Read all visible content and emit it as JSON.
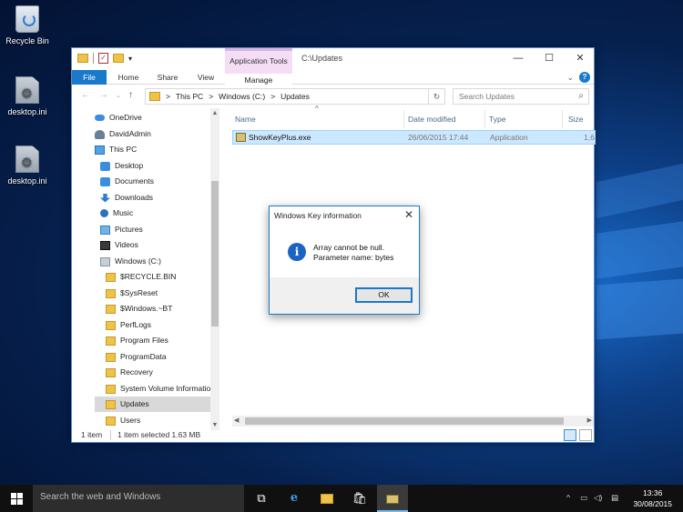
{
  "desktop": {
    "icons": [
      {
        "label": "Recycle Bin",
        "icon": "recycle-bin-icon"
      },
      {
        "label": "desktop.ini",
        "icon": "settings-file-icon"
      },
      {
        "label": "desktop.ini",
        "icon": "settings-file-icon"
      }
    ]
  },
  "explorer": {
    "title": "C:\\Updates",
    "app_tools": "Application Tools",
    "ribbon_tabs": [
      "File",
      "Home",
      "Share",
      "View",
      "Manage"
    ],
    "address": {
      "crumbs": [
        "This PC",
        "Windows (C:)",
        "Updates"
      ],
      "separator": ">"
    },
    "search_placeholder": "Search Updates",
    "nav_items": [
      {
        "label": "OneDrive",
        "icon": "cloud"
      },
      {
        "label": "DavidAdmin",
        "icon": "user"
      },
      {
        "label": "This PC",
        "icon": "pc"
      },
      {
        "label": "Desktop",
        "icon": "blue"
      },
      {
        "label": "Documents",
        "icon": "blue"
      },
      {
        "label": "Downloads",
        "icon": "dl"
      },
      {
        "label": "Music",
        "icon": "music"
      },
      {
        "label": "Pictures",
        "icon": "pics"
      },
      {
        "label": "Videos",
        "icon": "video"
      },
      {
        "label": "Windows (C:)",
        "icon": "drive"
      },
      {
        "label": "$RECYCLE.BIN",
        "icon": "folder"
      },
      {
        "label": "$SysReset",
        "icon": "folder"
      },
      {
        "label": "$Windows.~BT",
        "icon": "folder"
      },
      {
        "label": "PerfLogs",
        "icon": "folder"
      },
      {
        "label": "Program Files",
        "icon": "folder"
      },
      {
        "label": "ProgramData",
        "icon": "folder"
      },
      {
        "label": "Recovery",
        "icon": "folder"
      },
      {
        "label": "System Volume Informatio",
        "icon": "folder"
      },
      {
        "label": "Updates",
        "icon": "folder",
        "selected": true
      },
      {
        "label": "Users",
        "icon": "folder"
      }
    ],
    "columns": [
      "Name",
      "Date modified",
      "Type",
      "Size"
    ],
    "files": [
      {
        "name": "ShowKeyPlus.exe",
        "date": "26/06/2015 17:44",
        "type": "Application",
        "size": "1,6"
      }
    ],
    "status": {
      "count": "1 item",
      "selection": "1 item selected  1.63 MB"
    }
  },
  "dialog": {
    "title": "Windows Key information",
    "message_line1": "Array cannot be null.",
    "message_line2": "Parameter name: bytes",
    "ok": "OK"
  },
  "taskbar": {
    "search_placeholder": "Search the web and Windows",
    "time": "13:36",
    "date": "30/08/2015"
  }
}
